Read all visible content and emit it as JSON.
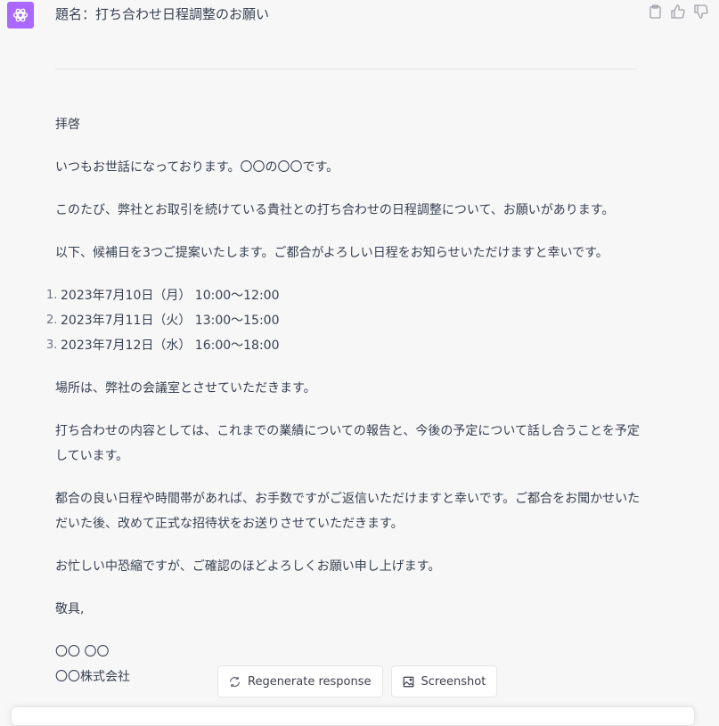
{
  "message": {
    "title": "題名：打ち合わせ日程調整のお願い",
    "paragraphs": [
      "拝啓",
      "いつもお世話になっております。〇〇の〇〇です。",
      "このたび、弊社とお取引を続けている貴社との打ち合わせの日程調整について、お願いがあります。",
      "以下、候補日を3つご提案いたします。ご都合がよろしい日程をお知らせいただけますと幸いです。"
    ],
    "list": [
      {
        "num": "1.",
        "text": "2023年7月10日（月） 10:00〜12:00"
      },
      {
        "num": "2.",
        "text": "2023年7月11日（火） 13:00〜15:00"
      },
      {
        "num": "3.",
        "text": "2023年7月12日（水） 16:00〜18:00"
      }
    ],
    "paragraphs2": [
      "場所は、弊社の会議室とさせていただきます。",
      "打ち合わせの内容としては、これまでの業績についての報告と、今後の予定について話し合うことを予定しています。",
      "都合の良い日程や時間帯があれば、お手数ですがご返信いただけますと幸いです。ご都合をお聞かせいただいた後、改めて正式な招待状をお送りさせていただきます。",
      "お忙しい中恐縮ですが、ご確認のほどよろしくお願い申し上げます。",
      "敬具,"
    ],
    "signature_name": "〇〇 〇〇",
    "signature_company": "〇〇株式会社"
  },
  "actions": {
    "regenerate": "Regenerate response",
    "screenshot": "Screenshot"
  },
  "colors": {
    "avatar": "#ab68ff",
    "background": "#f7f7f8"
  }
}
